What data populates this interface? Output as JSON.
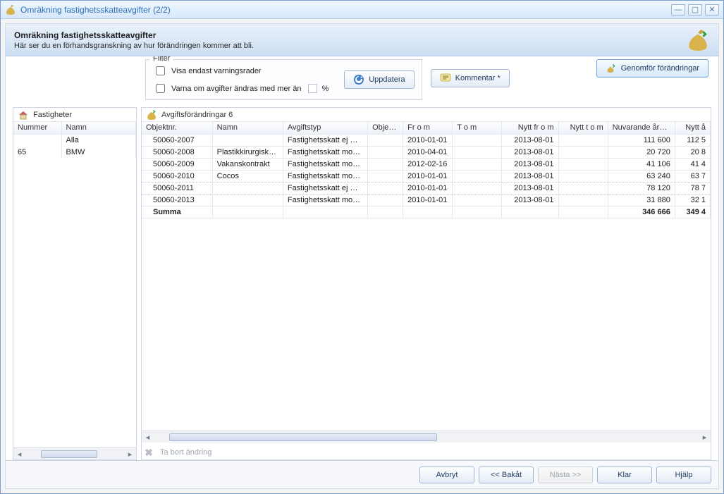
{
  "window": {
    "title": "Omräkning fastighetsskatteavgifter (2/2)"
  },
  "banner": {
    "heading": "Omräkning fastighetsskatteavgifter",
    "sub": "Här ser du en förhandsgranskning av hur förändringen kommer att bli."
  },
  "filter": {
    "legend": "Filter",
    "showWarnings": "Visa endast varningsrader",
    "warnIfMore": "Varna om avgifter ändras med mer än",
    "percent": "%",
    "value": ""
  },
  "actions": {
    "update": "Uppdatera",
    "comment": "Kommentar *",
    "commit": "Genomför förändringar",
    "removeChange": "Ta bort ändring"
  },
  "leftPanel": {
    "title": "Fastigheter",
    "columns": {
      "number": "Nummer",
      "name": "Namn"
    },
    "rows": [
      {
        "number": "",
        "name": "Alla"
      },
      {
        "number": "65",
        "name": "BMW"
      }
    ]
  },
  "rightPanel": {
    "title": "Avgiftsförändringar 6",
    "columns": {
      "objnr": "Objektnr.",
      "name": "Namn",
      "type": "Avgiftstyp",
      "objk": "Objek...",
      "from": "Fr o m",
      "tom": "T o m",
      "newfrom": "Nytt fr o m",
      "newtom": "Nytt t o m",
      "current": "Nuvarande årsb...",
      "newy": "Nytt å"
    },
    "rows": [
      {
        "objnr": "50060-2007",
        "name": "",
        "type": "Fastighetsskatt ej mo...",
        "objk": "",
        "from": "2010-01-01",
        "tom": "",
        "newfrom": "2013-08-01",
        "newtom": "",
        "current": "111 600",
        "newy": "112 5"
      },
      {
        "objnr": "50060-2008",
        "name": "Plastikkirurgiska ...",
        "type": "Fastighetsskatt mom...",
        "objk": "",
        "from": "2010-04-01",
        "tom": "",
        "newfrom": "2013-08-01",
        "newtom": "",
        "current": "20 720",
        "newy": "20 8"
      },
      {
        "objnr": "50060-2009",
        "name": "Vakanskontrakt",
        "type": "Fastighetsskatt mom...",
        "objk": "",
        "from": "2012-02-16",
        "tom": "",
        "newfrom": "2013-08-01",
        "newtom": "",
        "current": "41 106",
        "newy": "41 4"
      },
      {
        "objnr": "50060-2010",
        "name": "Cocos",
        "type": "Fastighetsskatt mom...",
        "objk": "",
        "from": "2010-01-01",
        "tom": "",
        "newfrom": "2013-08-01",
        "newtom": "",
        "current": "63 240",
        "newy": "63 7"
      },
      {
        "objnr": "50060-2011",
        "name": "",
        "type": "Fastighetsskatt ej mo...",
        "objk": "",
        "from": "2010-01-01",
        "tom": "",
        "newfrom": "2013-08-01",
        "newtom": "",
        "current": "78 120",
        "newy": "78 7"
      },
      {
        "objnr": "50060-2013",
        "name": "",
        "type": "Fastighetsskatt mom...",
        "objk": "",
        "from": "2010-01-01",
        "tom": "",
        "newfrom": "2013-08-01",
        "newtom": "",
        "current": "31 880",
        "newy": "32 1"
      }
    ],
    "summary": {
      "label": "Summa",
      "current": "346 666",
      "newy": "349 4"
    }
  },
  "footer": {
    "cancel": "Avbryt",
    "back": "<< Bakåt",
    "next": "Nästa >>",
    "done": "Klar",
    "help": "Hjälp"
  }
}
